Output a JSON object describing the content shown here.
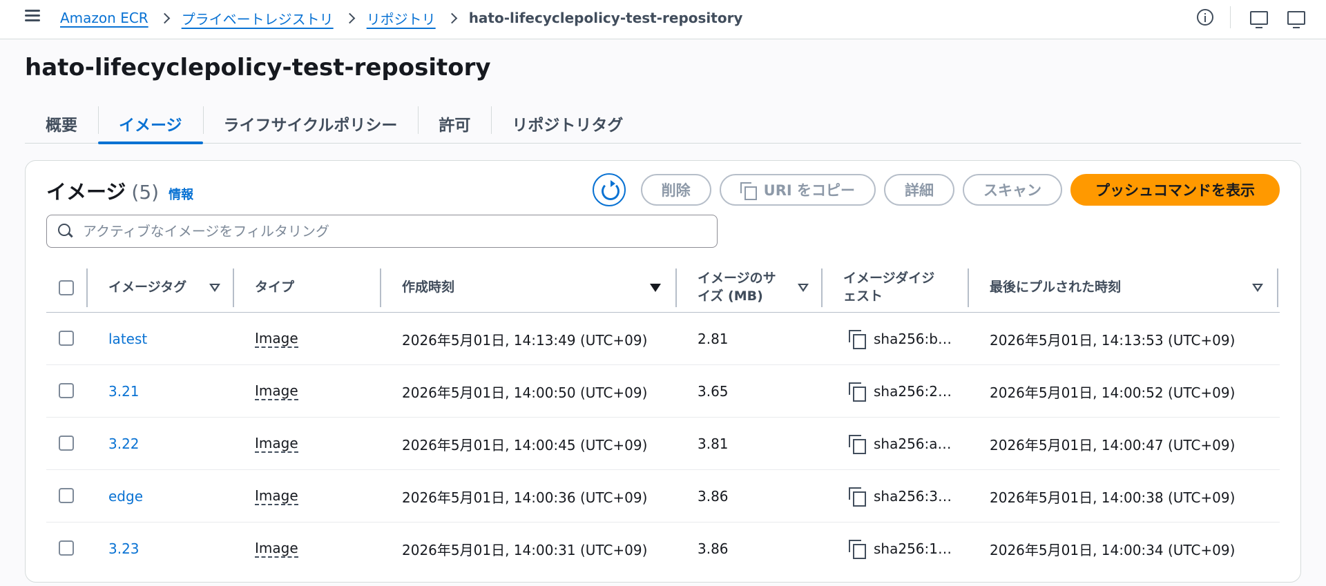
{
  "breadcrumb": {
    "items": [
      "Amazon ECR",
      "プライベートレジストリ",
      "リポジトリ"
    ],
    "current": "hato-lifecyclepolicy-test-repository"
  },
  "page": {
    "title": "hato-lifecyclepolicy-test-repository"
  },
  "tabs": [
    {
      "label": "概要",
      "active": false
    },
    {
      "label": "イメージ",
      "active": true
    },
    {
      "label": "ライフサイクルポリシー",
      "active": false
    },
    {
      "label": "許可",
      "active": false
    },
    {
      "label": "リポジトリタグ",
      "active": false
    }
  ],
  "panel": {
    "title": "イメージ",
    "count": "(5)",
    "info": "情報",
    "actions": {
      "delete": "削除",
      "copy_uri": "URI をコピー",
      "details": "詳細",
      "scan": "スキャン",
      "push": "プッシュコマンドを表示"
    },
    "filter_placeholder": "アクティブなイメージをフィルタリング"
  },
  "table": {
    "columns": {
      "tag": "イメージタグ",
      "type": "タイプ",
      "created": "作成時刻",
      "size_line1": "イメージのサ",
      "size_line2": "イズ (MB)",
      "digest_line1": "イメージダイジ",
      "digest_line2": "ェスト",
      "pulled": "最後にプルされた時刻"
    },
    "rows": [
      {
        "tag": "latest",
        "type": "Image",
        "created": "2026年5月01日, 14:13:49 (UTC+09)",
        "size": "2.81",
        "digest": "sha256:b…",
        "pulled": "2026年5月01日, 14:13:53 (UTC+09)"
      },
      {
        "tag": "3.21",
        "type": "Image",
        "created": "2026年5月01日, 14:00:50 (UTC+09)",
        "size": "3.65",
        "digest": "sha256:2…",
        "pulled": "2026年5月01日, 14:00:52 (UTC+09)"
      },
      {
        "tag": "3.22",
        "type": "Image",
        "created": "2026年5月01日, 14:00:45 (UTC+09)",
        "size": "3.81",
        "digest": "sha256:a…",
        "pulled": "2026年5月01日, 14:00:47 (UTC+09)"
      },
      {
        "tag": "edge",
        "type": "Image",
        "created": "2026年5月01日, 14:00:36 (UTC+09)",
        "size": "3.86",
        "digest": "sha256:3…",
        "pulled": "2026年5月01日, 14:00:38 (UTC+09)"
      },
      {
        "tag": "3.23",
        "type": "Image",
        "created": "2026年5月01日, 14:00:31 (UTC+09)",
        "size": "3.86",
        "digest": "sha256:1…",
        "pulled": "2026年5月01日, 14:00:34 (UTC+09)"
      }
    ]
  },
  "icons": {
    "menu": "hamburger-menu-icon",
    "info": "info-icon",
    "feedback": "feedback-screen-icon",
    "preferences": "screen-settings-icon",
    "refresh": "refresh-icon",
    "search": "search-icon",
    "copy": "copy-icon",
    "sort": "sort-caret-icon"
  },
  "colors": {
    "link": "#0972d3",
    "primary_button": "#ff9900",
    "text": "#16191f",
    "disabled": "#8d99a8"
  }
}
